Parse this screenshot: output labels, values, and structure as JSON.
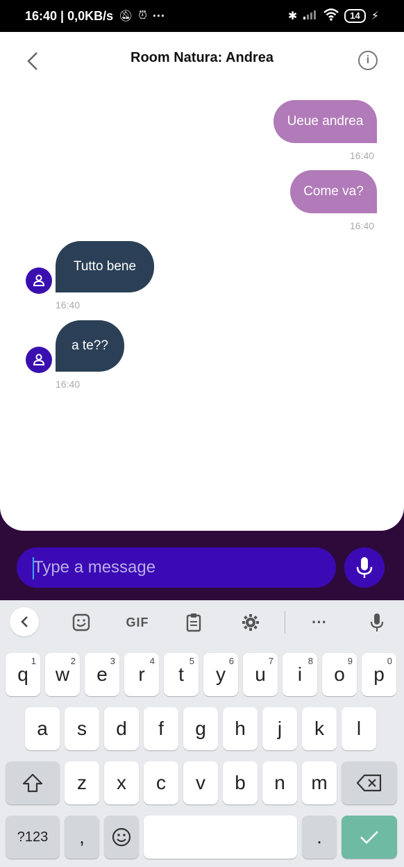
{
  "status_bar": {
    "time_speed": "16:40 | 0,0KB/s",
    "more": "···",
    "battery": "14"
  },
  "header": {
    "title": "Room Natura: Andrea"
  },
  "messages": [
    {
      "direction": "out",
      "text": "Ueue andrea",
      "time": "16:40"
    },
    {
      "direction": "out",
      "text": "Come va?",
      "time": "16:40"
    },
    {
      "direction": "in",
      "text": "Tutto bene",
      "time": "16:40"
    },
    {
      "direction": "in",
      "text": "a te??",
      "time": "16:40"
    }
  ],
  "composer": {
    "placeholder": "Type a message"
  },
  "keyboard": {
    "toolbar": {
      "gif": "GIF",
      "more": "···"
    },
    "row1": [
      {
        "key": "q",
        "hint": "1"
      },
      {
        "key": "w",
        "hint": "2"
      },
      {
        "key": "e",
        "hint": "3"
      },
      {
        "key": "r",
        "hint": "4"
      },
      {
        "key": "t",
        "hint": "5"
      },
      {
        "key": "y",
        "hint": "6"
      },
      {
        "key": "u",
        "hint": "7"
      },
      {
        "key": "i",
        "hint": "8"
      },
      {
        "key": "o",
        "hint": "9"
      },
      {
        "key": "p",
        "hint": "0"
      }
    ],
    "row2": [
      "a",
      "s",
      "d",
      "f",
      "g",
      "h",
      "j",
      "k",
      "l"
    ],
    "row3": [
      "z",
      "x",
      "c",
      "v",
      "b",
      "n",
      "m"
    ],
    "symbols": "?123",
    "comma": ",",
    "period": "."
  },
  "colors": {
    "outgoing_bubble": "#b17ab8",
    "incoming_bubble": "#2b4056",
    "accent": "#3b0ab5",
    "enter_key": "#6ebaa3"
  }
}
